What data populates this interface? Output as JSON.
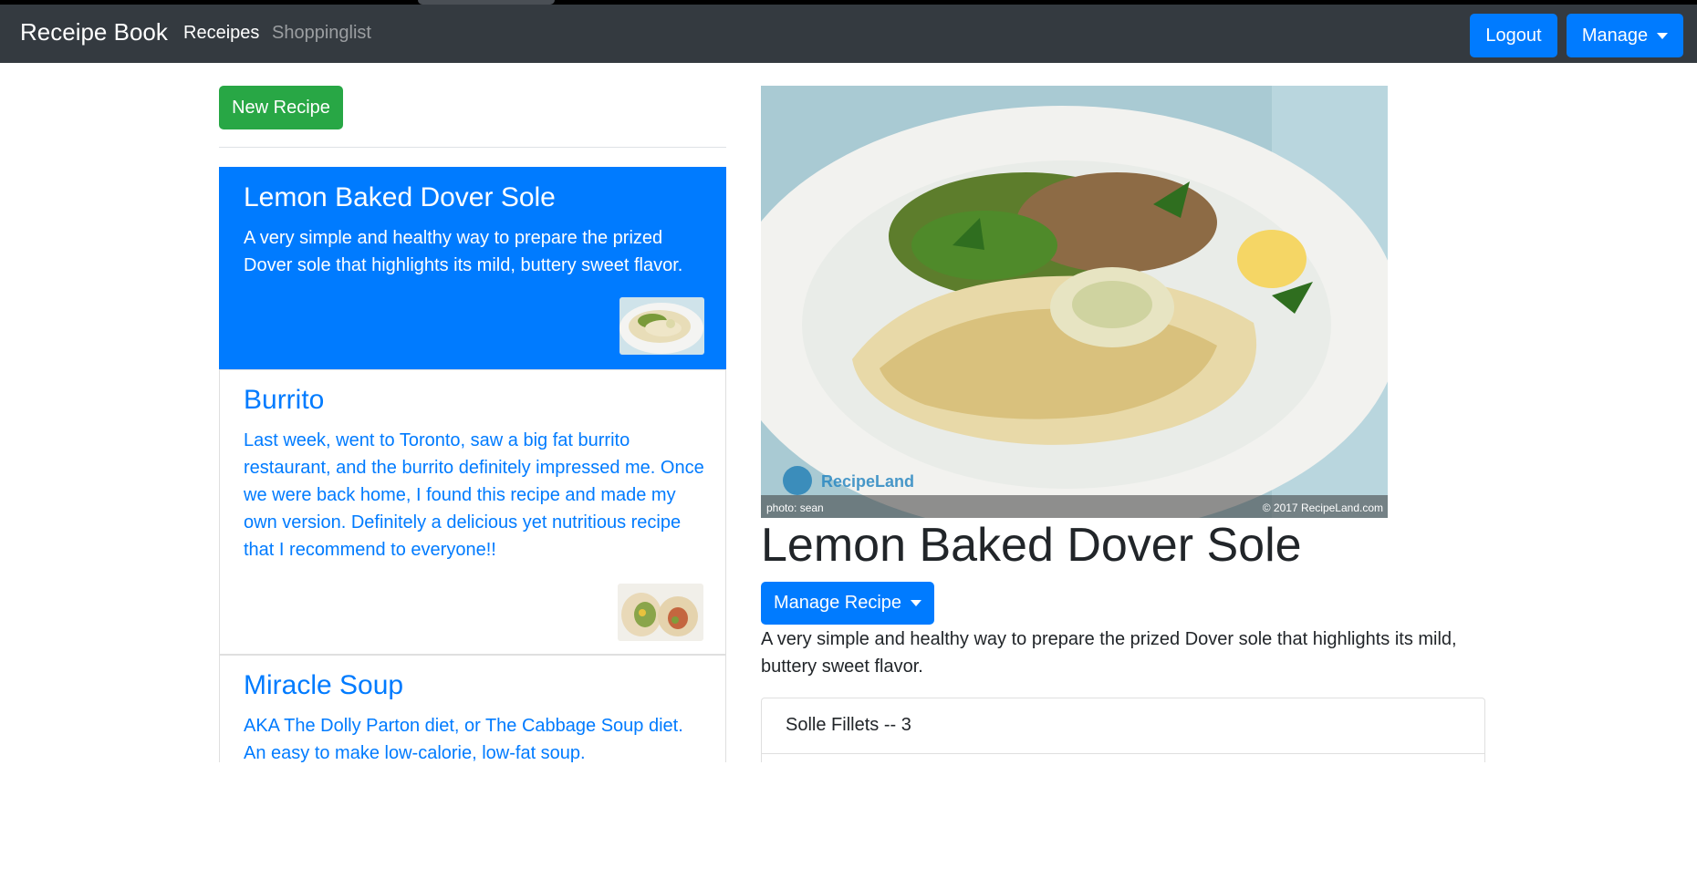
{
  "navbar": {
    "brand": "Receipe Book",
    "links": [
      {
        "label": "Receipes",
        "active": true
      },
      {
        "label": "Shoppinglist",
        "active": false
      }
    ],
    "logout_label": "Logout",
    "manage_label": "Manage"
  },
  "sidebar": {
    "new_recipe_label": "New Recipe",
    "recipes": [
      {
        "name": "Lemon Baked Dover Sole",
        "description": "A very simple and healthy way to prepare the prized Dover sole that highlights its mild, buttery sweet flavor.",
        "active": true
      },
      {
        "name": "Burrito",
        "description": "Last week, went to Toronto, saw a big fat burrito restaurant, and the burrito definitely impressed me. Once we were back home, I found this recipe and made my own version. Definitely a delicious yet nutritious recipe that I recommend to everyone!!",
        "active": false
      },
      {
        "name": "Miracle Soup",
        "description": "AKA The Dolly Parton diet, or The Cabbage Soup diet. An easy to make low-calorie, low-fat soup.",
        "active": false
      }
    ]
  },
  "detail": {
    "image_credit_left": "photo: sean",
    "image_credit_right": "© 2017 RecipeLand.com",
    "image_watermark": "RecipeLand",
    "title": "Lemon Baked Dover Sole",
    "manage_recipe_label": "Manage Recipe",
    "description": "A very simple and healthy way to prepare the prized Dover sole that highlights its mild, buttery sweet flavor.",
    "ingredients": [
      "Solle Fillets -- 3"
    ]
  },
  "colors": {
    "primary": "#007bff",
    "success": "#28a745",
    "navbar": "#343a40"
  }
}
